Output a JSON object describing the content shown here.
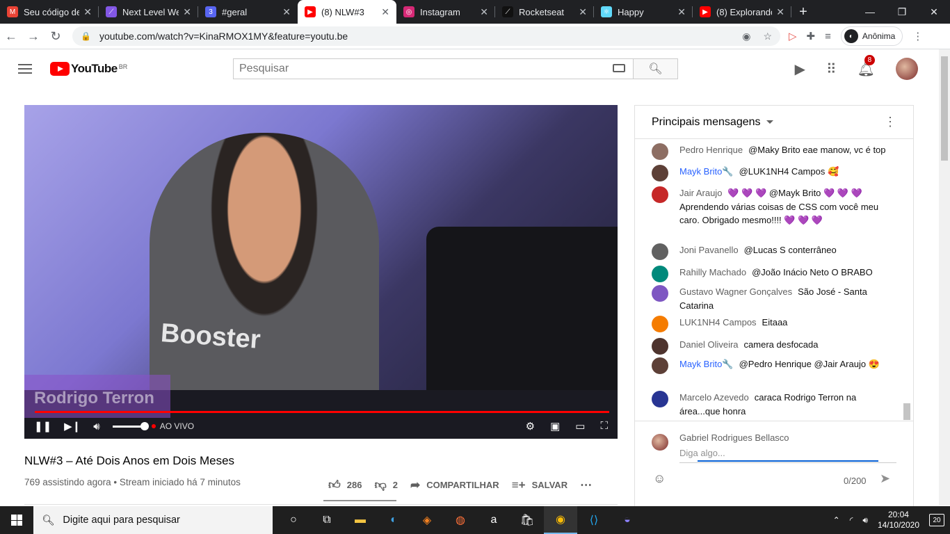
{
  "browser": {
    "tabs": [
      {
        "title": "Seu código de",
        "icon": "gmail-icon",
        "color": "#ea4335",
        "glyph": "M"
      },
      {
        "title": "Next Level We",
        "icon": "nlw-icon",
        "color": "#8257e5",
        "glyph": "⟋"
      },
      {
        "title": "#geral",
        "icon": "discord-icon",
        "color": "#5865f2",
        "glyph": "3"
      },
      {
        "title": "(8) NLW#3",
        "icon": "youtube-icon",
        "color": "#ff0000",
        "glyph": "▶"
      },
      {
        "title": "Instagram",
        "icon": "instagram-icon",
        "color": "#d62976",
        "glyph": "◎"
      },
      {
        "title": "Rocketseat",
        "icon": "rocketseat-icon",
        "color": "#111111",
        "glyph": "⟋"
      },
      {
        "title": "Happy",
        "icon": "react-icon",
        "color": "#61dafb",
        "glyph": "⚛"
      },
      {
        "title": "(8) Explorando",
        "icon": "youtube-icon",
        "color": "#ff0000",
        "glyph": "▶"
      }
    ],
    "active_tab_index": 3,
    "url": "youtube.com/watch?v=KinaRMOX1MY&feature=youtu.be",
    "profile_label": "Anônima"
  },
  "youtube": {
    "logo_text": "YouTube",
    "logo_region": "BR",
    "search_placeholder": "Pesquisar",
    "notifications_count": "8",
    "brand_color": "#ff0000"
  },
  "player": {
    "overlay_name": "Rodrigo Terron",
    "live_label": "AO VIVO",
    "shirt_text": "Booster"
  },
  "video": {
    "title": "NLW#3 – Até Dois Anos em Dois Meses",
    "meta": "769 assistindo agora • Stream iniciado há 7 minutos",
    "likes": "286",
    "dislikes": "2",
    "share_label": "COMPARTILHAR",
    "save_label": "SALVAR"
  },
  "chat": {
    "header": "Principais mensagens",
    "messages": [
      {
        "author": "Pedro Henrique",
        "text": "@Maky Brito eae manow, vc é top",
        "owner": false,
        "avatar_color": "#8d6e63"
      },
      {
        "author": "Mayk Brito🔧",
        "text": "@LUK1NH4 Campos 🥰",
        "owner": true,
        "avatar_color": "#5d4037"
      },
      {
        "author": "Jair Araujo",
        "text": "💜 💜 💜 @Mayk Brito 💜 💜 💜 Aprendendo várias coisas de CSS com você meu caro. Obrigado mesmo!!!! 💜 💜 💜",
        "owner": false,
        "avatar_color": "#c62828"
      },
      {
        "author": "Joni Pavanello",
        "text": "@Lucas S conterrâneo",
        "owner": false,
        "avatar_color": "#616161"
      },
      {
        "author": "Rahilly Machado",
        "text": "@João Inácio Neto O BRABO",
        "owner": false,
        "avatar_color": "#00897b"
      },
      {
        "author": "Gustavo Wagner Gonçalves",
        "text": "São José - Santa Catarina",
        "owner": false,
        "avatar_color": "#7e57c2"
      },
      {
        "author": "LUK1NH4 Campos",
        "text": "Eitaaa",
        "owner": false,
        "avatar_color": "#f57c00"
      },
      {
        "author": "Daniel Oliveira",
        "text": "camera desfocada",
        "owner": false,
        "avatar_color": "#4e342e"
      },
      {
        "author": "Mayk Brito🔧",
        "text": "@Pedro Henrique @Jair Araujo 😍",
        "owner": true,
        "avatar_color": "#5d4037"
      },
      {
        "author": "Marcelo Azevedo",
        "text": "caraca Rodrigo Terron na área...que honra",
        "owner": false,
        "avatar_color": "#283593"
      }
    ],
    "composer_name": "Gabriel Rodrigues Bellasco",
    "composer_placeholder": "Diga algo...",
    "char_count": "0/200"
  },
  "taskbar": {
    "search_placeholder": "Digite aqui para pesquisar",
    "time": "20:04",
    "date": "14/10/2020",
    "notifications": "20"
  }
}
